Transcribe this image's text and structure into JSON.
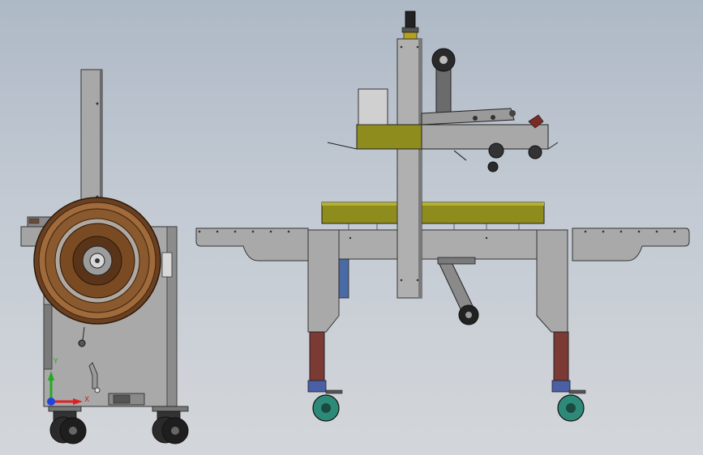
{
  "triad": {
    "x_label": "X",
    "y_label": "Y"
  },
  "colors": {
    "background_top": "#aeb9c6",
    "background_bottom": "#d3d6da",
    "machine_gray": "#a9a9a9",
    "strap_reel": "#8a5a2e",
    "conveyor_olive": "#8f8c1e",
    "caster_wheel_teal": "#2e8a78",
    "caster_fork_blue": "#4a5fa5",
    "leg_brown": "#7c3a34",
    "axis_x": "#dd2222",
    "axis_y": "#22aa22",
    "axis_z": "#2244dd"
  },
  "icons": {
    "strapping_machine": "strapping-machine-side-view",
    "case_sealer": "carton-sealer-front-view",
    "axis_triad": "coordinate-axis-triad"
  }
}
